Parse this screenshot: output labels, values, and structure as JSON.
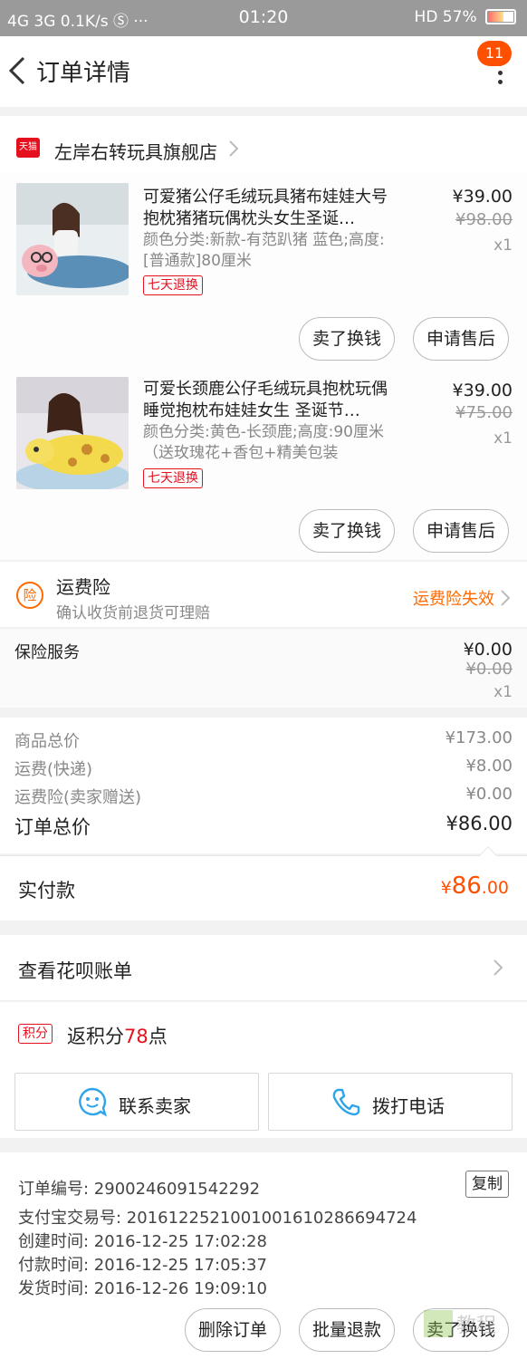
{
  "status_bar": {
    "left": "4G  3G  0.1K/s  Ⓢ  ···",
    "time": "01:20",
    "right": "HD  57%",
    "battery_level": 0.57
  },
  "nav": {
    "title": "订单详情",
    "badge": "11"
  },
  "store": {
    "tag": "天猫",
    "name": "左岸右转玩具旗舰店"
  },
  "items": [
    {
      "title": "可爱猪公仔毛绒玩具猪布娃娃大号抱枕猪猪玩偶枕头女生圣诞…",
      "spec": "颜色分类:新款-有范趴猪 蓝色;高度:[普通款]80厘米",
      "tag": "七天退换",
      "price": "¥39.00",
      "original_price": "¥98.00",
      "qty": "x1",
      "btn_sell": "卖了换钱",
      "btn_after": "申请售后"
    },
    {
      "title": "可爱长颈鹿公仔毛绒玩具抱枕玩偶睡觉抱枕布娃娃女生 圣诞节…",
      "spec": "颜色分类:黄色-长颈鹿;高度:90厘米（送玫瑰花+香包+精美包装",
      "tag": "七天退换",
      "price": "¥39.00",
      "original_price": "¥75.00",
      "qty": "x1",
      "btn_sell": "卖了换钱",
      "btn_after": "申请售后"
    }
  ],
  "freight_insurance": {
    "icon": "险",
    "title": "运费险",
    "subtitle": "确认收货前退货可理赔",
    "status": "运费险失效"
  },
  "insurance_service": {
    "label": "保险服务",
    "price": "¥0.00",
    "original_price": "¥0.00",
    "qty": "x1"
  },
  "summary": {
    "goods_label": "商品总价",
    "goods_value": "¥173.00",
    "shipping_label": "运费(快递)",
    "shipping_value": "¥8.00",
    "freight_ins_label": "运费险(卖家赠送)",
    "freight_ins_value": "¥0.00",
    "total_label": "订单总价",
    "total_value": "¥86.00"
  },
  "payment": {
    "label": "实付款",
    "currency": "¥",
    "int": "86",
    "dec": ".00"
  },
  "huabei": {
    "label": "查看花呗账单"
  },
  "points": {
    "tag": "积分",
    "prefix": "返积分",
    "number": "78",
    "suffix": "点"
  },
  "contact": {
    "seller": "联系卖家",
    "phone": "拨打电话"
  },
  "order_info": {
    "order_no": "订单编号: 2900246091542292",
    "alipay_no": "支付宝交易号: 2016122521001001610286694724",
    "created": "创建时间: 2016-12-25 17:02:28",
    "paid": "付款时间: 2016-12-25 17:05:37",
    "shipped": "发货时间: 2016-12-26 19:09:10",
    "copy": "复制"
  },
  "bottom_actions": {
    "delete": "删除订单",
    "refund": "批量退款",
    "sell": "卖了换钱"
  },
  "colors": {
    "accent": "#ff5000",
    "tmall_red": "#e4101e",
    "link_blue": "#2fa5e8"
  }
}
